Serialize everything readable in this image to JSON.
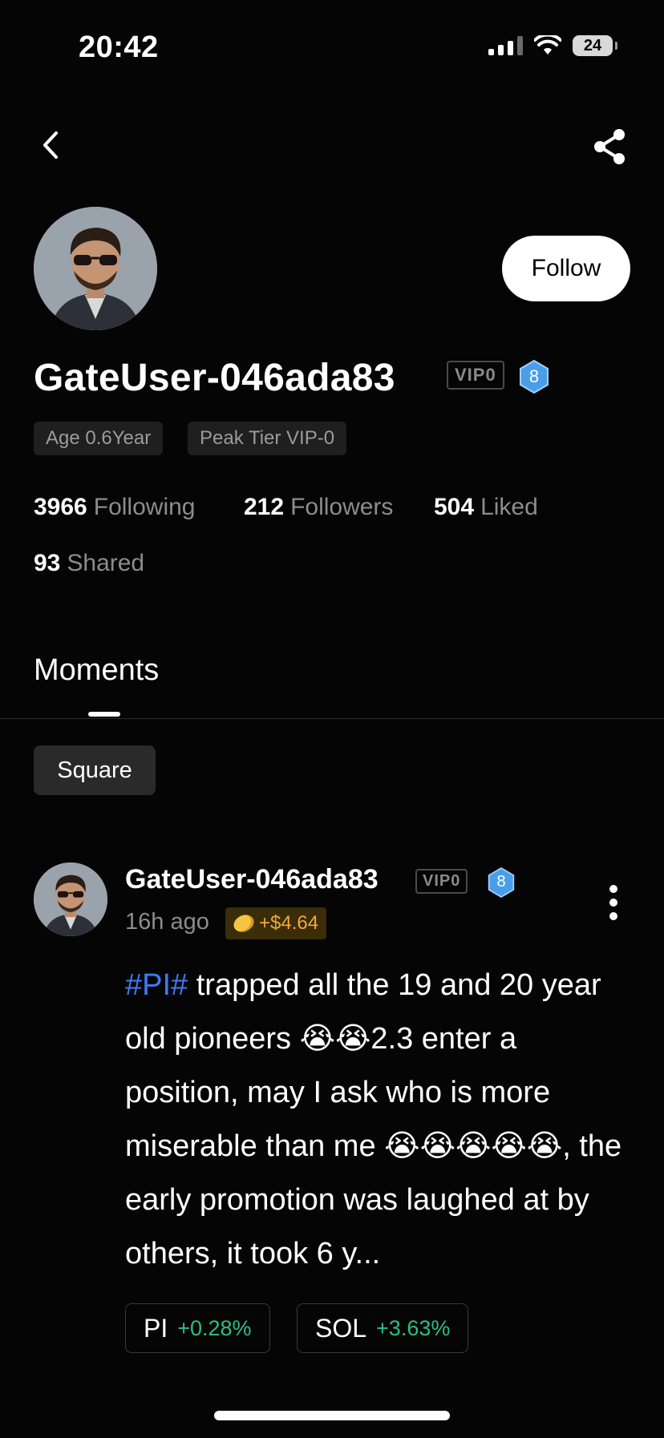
{
  "status_bar": {
    "time": "20:42",
    "battery": "24"
  },
  "profile": {
    "username": "GateUser-046ada83",
    "vip_label": "VIP0",
    "level": "8",
    "follow_label": "Follow",
    "tags": {
      "age": "Age 0.6Year",
      "peak_tier": "Peak Tier VIP-0"
    },
    "stats": {
      "following_count": "3966",
      "following_label": "Following",
      "followers_count": "212",
      "followers_label": "Followers",
      "liked_count": "504",
      "liked_label": "Liked",
      "shared_count": "93",
      "shared_label": "Shared"
    }
  },
  "tabs": {
    "moments": "Moments"
  },
  "filter": {
    "square": "Square"
  },
  "post": {
    "author": "GateUser-046ada83",
    "vip_label": "VIP0",
    "level": "8",
    "time_ago": "16h ago",
    "earnings": "+$4.64",
    "hashtag": "#PI#",
    "text_1": " trapped all the 19 and 20 year old pioneers ",
    "text_2": "2.3 enter a position, may I ask who is more miserable than me ",
    "text_3": ", the early promotion was laughed at by others, it took 6 y...",
    "emoji": "😭",
    "coins": [
      {
        "symbol": "PI",
        "change": "+0.28%"
      },
      {
        "symbol": "SOL",
        "change": "+3.63%"
      }
    ]
  },
  "colors": {
    "accent_blue": "#3d7bf5",
    "up_green": "#2ebd85",
    "gold": "#f2a93b",
    "level_blue": "#4a9ee8"
  }
}
